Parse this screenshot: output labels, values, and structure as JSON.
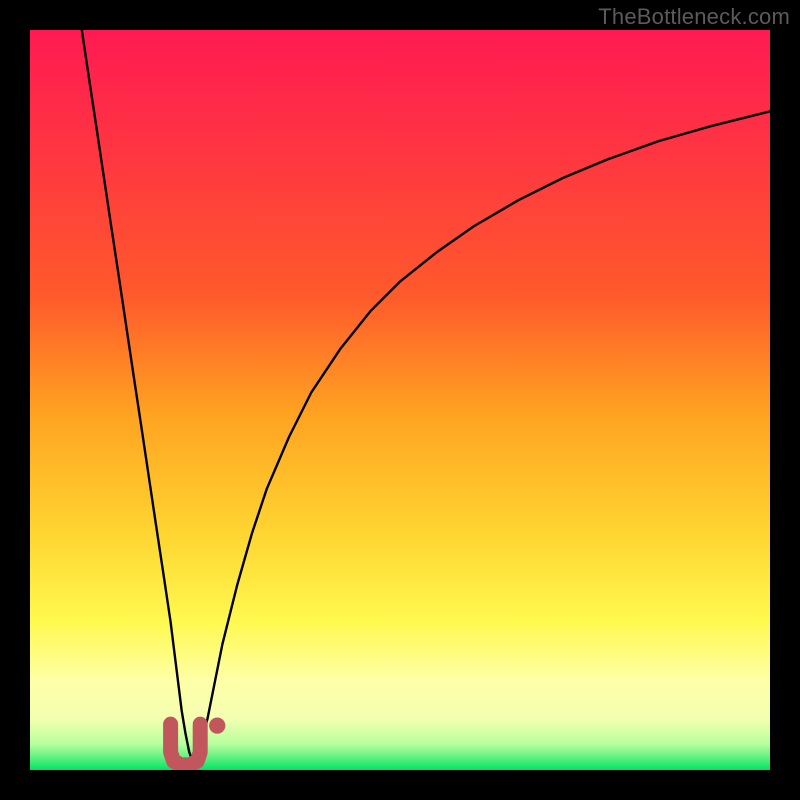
{
  "watermark": "TheBottleneck.com",
  "colors": {
    "frame": "#000000",
    "gradient_top": "#ff1a52",
    "gradient_upper": "#ff5a2b",
    "gradient_mid": "#ffa321",
    "gradient_lower": "#ffd531",
    "gradient_yellow": "#fff94f",
    "gradient_pale": "#f3ffb0",
    "gradient_green": "#00e463",
    "curve": "#000000",
    "marker_fill": "#c1575d",
    "marker_stroke": "#c1575d"
  },
  "chart_data": {
    "type": "line",
    "title": "",
    "xlabel": "",
    "ylabel": "",
    "xlim": [
      0,
      100
    ],
    "ylim": [
      0,
      100
    ],
    "sweet_spot_x": 22,
    "series": [
      {
        "name": "bottleneck-curve-left",
        "x": [
          7,
          8,
          9,
          10,
          11,
          12,
          13,
          14,
          15,
          16,
          17,
          18,
          19,
          19.5,
          20,
          20.5,
          21,
          21.5,
          22
        ],
        "y": [
          100,
          93.3,
          86.7,
          80,
          73.3,
          66.7,
          60,
          53.3,
          46.7,
          40,
          33.3,
          26.7,
          20,
          16,
          12,
          8,
          5,
          2.5,
          1
        ]
      },
      {
        "name": "bottleneck-curve-right",
        "x": [
          22,
          23,
          24,
          25,
          26,
          28,
          30,
          32,
          35,
          38,
          42,
          46,
          50,
          55,
          60,
          66,
          72,
          78,
          85,
          92,
          100
        ],
        "y": [
          1,
          3,
          7,
          12,
          17,
          25,
          32,
          38,
          45,
          51,
          57,
          62,
          66,
          70,
          73.5,
          77,
          80,
          82.5,
          85,
          87,
          89
        ]
      }
    ],
    "markers": {
      "name": "letter",
      "glyph_outline": [
        {
          "x": 19.0,
          "y": 6.2
        },
        {
          "x": 19.0,
          "y": 2.4
        },
        {
          "x": 19.4,
          "y": 1.2
        },
        {
          "x": 20.4,
          "y": 0.7
        },
        {
          "x": 21.6,
          "y": 0.7
        },
        {
          "x": 22.6,
          "y": 1.2
        },
        {
          "x": 23.0,
          "y": 2.4
        },
        {
          "x": 23.0,
          "y": 6.2
        }
      ],
      "dot": {
        "x": 25.3,
        "y": 6.0,
        "r": 1.1
      }
    }
  }
}
